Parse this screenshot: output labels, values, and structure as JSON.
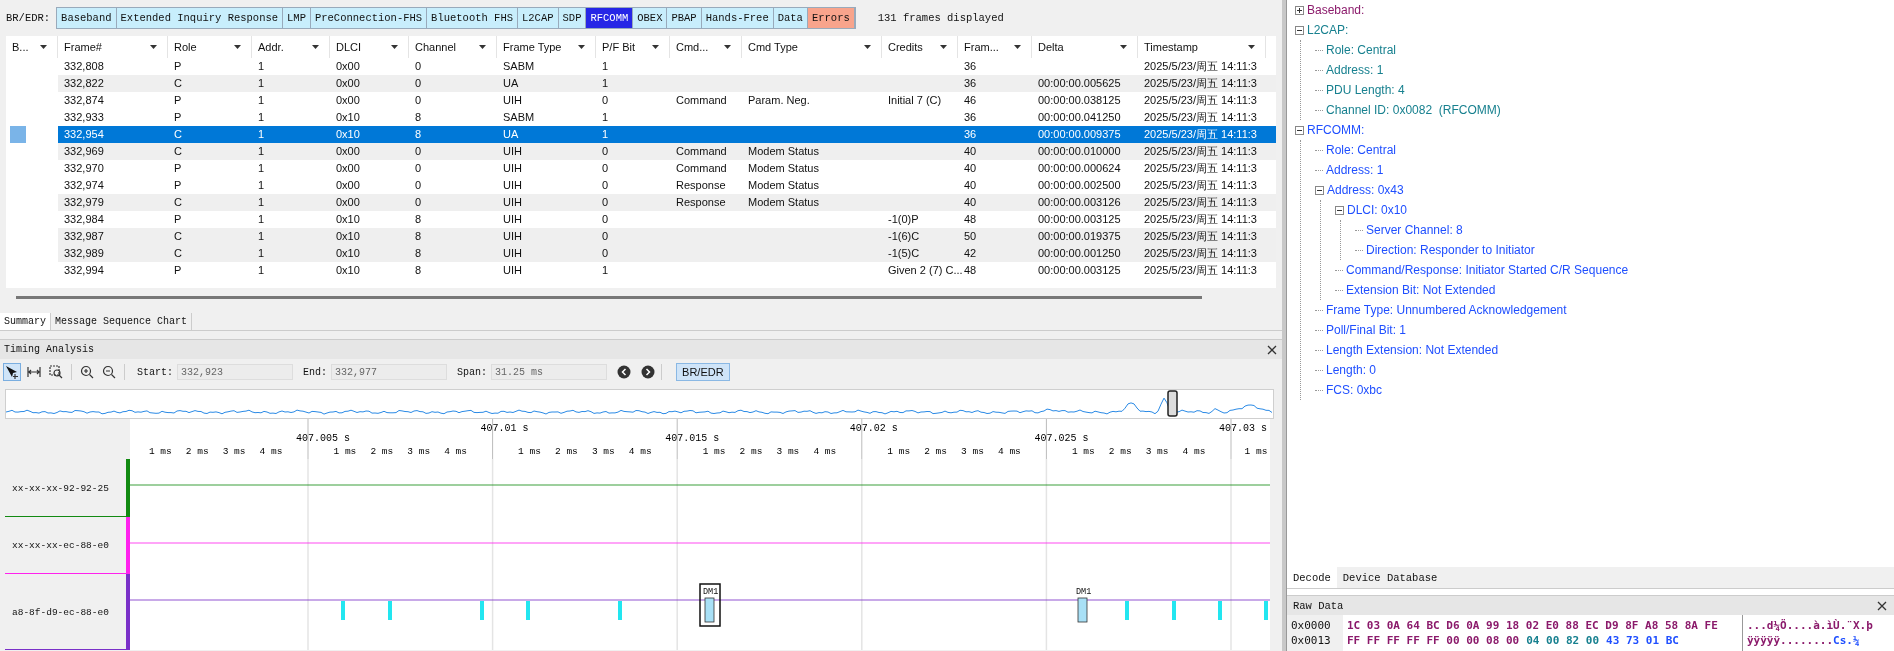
{
  "filter_bar": {
    "label": "BR/EDR:",
    "tabs": [
      {
        "label": "Baseband",
        "kind": "protocol",
        "selected": false
      },
      {
        "label": "Extended Inquiry Response",
        "kind": "protocol",
        "selected": false
      },
      {
        "label": "LMP",
        "kind": "protocol",
        "selected": false
      },
      {
        "label": "PreConnection-FHS",
        "kind": "protocol",
        "selected": false
      },
      {
        "label": "Bluetooth FHS",
        "kind": "protocol",
        "selected": false
      },
      {
        "label": "L2CAP",
        "kind": "protocol",
        "selected": false
      },
      {
        "label": "SDP",
        "kind": "protocol",
        "selected": false
      },
      {
        "label": "RFCOMM",
        "kind": "protocol",
        "selected": true
      },
      {
        "label": "OBEX",
        "kind": "protocol",
        "selected": false
      },
      {
        "label": "PBAP",
        "kind": "protocol",
        "selected": false
      },
      {
        "label": "Hands-Free",
        "kind": "protocol",
        "selected": false
      },
      {
        "label": "Data",
        "kind": "protocol",
        "selected": false
      },
      {
        "label": "Errors",
        "kind": "errors",
        "selected": false
      }
    ],
    "status": "131 frames displayed"
  },
  "table": {
    "columns": [
      "B...",
      "Frame#",
      "Role",
      "Addr.",
      "DLCI",
      "Channel",
      "Frame Type",
      "P/F Bit",
      "Cmd...",
      "Cmd Type",
      "Credits",
      "Fram...",
      "Delta",
      "Timestamp"
    ],
    "rows": [
      {
        "frame": "332,808",
        "role": "P",
        "address": "1",
        "dlci": "0x00",
        "channel": "0",
        "frame_type": "SABM",
        "pf_bit": "1",
        "frame_length": "36",
        "timestamp": "2025/5/23/周五 14:11:3",
        "selected": false,
        "shaded": false
      },
      {
        "frame": "332,822",
        "role": "C",
        "address": "1",
        "dlci": "0x00",
        "channel": "0",
        "frame_type": "UA",
        "pf_bit": "1",
        "frame_length": "36",
        "delta": "00:00:00.005625",
        "timestamp": "2025/5/23/周五 14:11:3",
        "selected": false,
        "shaded": true
      },
      {
        "frame": "332,874",
        "role": "P",
        "address": "1",
        "dlci": "0x00",
        "channel": "0",
        "frame_type": "UIH",
        "pf_bit": "0",
        "cmd": "Command",
        "cmd_type": "Param. Neg.",
        "credits": "Initial 7 (C)",
        "frame_length": "46",
        "delta": "00:00:00.038125",
        "timestamp": "2025/5/23/周五 14:11:3",
        "selected": false,
        "shaded": false
      },
      {
        "frame": "332,933",
        "role": "P",
        "address": "1",
        "dlci": "0x10",
        "channel": "8",
        "frame_type": "SABM",
        "pf_bit": "1",
        "frame_length": "36",
        "delta": "00:00:00.041250",
        "timestamp": "2025/5/23/周五 14:11:3",
        "selected": false,
        "shaded": false
      },
      {
        "frame": "332,954",
        "role": "C",
        "address": "1",
        "dlci": "0x10",
        "channel": "8",
        "frame_type": "UA",
        "pf_bit": "1",
        "frame_length": "36",
        "delta": "00:00:00.009375",
        "timestamp": "2025/5/23/周五 14:11:3",
        "selected": true,
        "shaded": false
      },
      {
        "frame": "332,969",
        "role": "C",
        "address": "1",
        "dlci": "0x00",
        "channel": "0",
        "frame_type": "UIH",
        "pf_bit": "0",
        "cmd": "Command",
        "cmd_type": "Modem Status",
        "frame_length": "40",
        "delta": "00:00:00.010000",
        "timestamp": "2025/5/23/周五 14:11:3",
        "selected": false,
        "shaded": true
      },
      {
        "frame": "332,970",
        "role": "P",
        "address": "1",
        "dlci": "0x00",
        "channel": "0",
        "frame_type": "UIH",
        "pf_bit": "0",
        "cmd": "Command",
        "cmd_type": "Modem Status",
        "frame_length": "40",
        "delta": "00:00:00.000624",
        "timestamp": "2025/5/23/周五 14:11:3",
        "selected": false,
        "shaded": false
      },
      {
        "frame": "332,974",
        "role": "P",
        "address": "1",
        "dlci": "0x00",
        "channel": "0",
        "frame_type": "UIH",
        "pf_bit": "0",
        "cmd": "Response",
        "cmd_type": "Modem Status",
        "frame_length": "40",
        "delta": "00:00:00.002500",
        "timestamp": "2025/5/23/周五 14:11:3",
        "selected": false,
        "shaded": false
      },
      {
        "frame": "332,979",
        "role": "C",
        "address": "1",
        "dlci": "0x00",
        "channel": "0",
        "frame_type": "UIH",
        "pf_bit": "0",
        "cmd": "Response",
        "cmd_type": "Modem Status",
        "frame_length": "40",
        "delta": "00:00:00.003126",
        "timestamp": "2025/5/23/周五 14:11:3",
        "selected": false,
        "shaded": true
      },
      {
        "frame": "332,984",
        "role": "P",
        "address": "1",
        "dlci": "0x10",
        "channel": "8",
        "frame_type": "UIH",
        "pf_bit": "0",
        "credits": "-1(0)P",
        "frame_length": "48",
        "delta": "00:00:00.003125",
        "timestamp": "2025/5/23/周五 14:11:3",
        "selected": false,
        "shaded": false
      },
      {
        "frame": "332,987",
        "role": "C",
        "address": "1",
        "dlci": "0x10",
        "channel": "8",
        "frame_type": "UIH",
        "pf_bit": "0",
        "credits": "-1(6)C",
        "frame_length": "50",
        "delta": "00:00:00.019375",
        "timestamp": "2025/5/23/周五 14:11:3",
        "selected": false,
        "shaded": true
      },
      {
        "frame": "332,989",
        "role": "C",
        "address": "1",
        "dlci": "0x10",
        "channel": "8",
        "frame_type": "UIH",
        "pf_bit": "0",
        "credits": "-1(5)C",
        "frame_length": "42",
        "delta": "00:00:00.001250",
        "timestamp": "2025/5/23/周五 14:11:3",
        "selected": false,
        "shaded": true
      },
      {
        "frame": "332,994",
        "role": "P",
        "address": "1",
        "dlci": "0x10",
        "channel": "8",
        "frame_type": "UIH",
        "pf_bit": "1",
        "credits": "Given 2 (7) C...",
        "frame_length": "48",
        "delta": "00:00:00.003125",
        "timestamp": "2025/5/23/周五 14:11:3",
        "selected": false,
        "shaded": false
      }
    ]
  },
  "view_tabs": [
    {
      "label": "Summary",
      "selected": true
    },
    {
      "label": "Message Sequence Chart",
      "selected": false
    }
  ],
  "timing": {
    "title": "Timing Analysis",
    "tools": [
      {
        "kind": "pointer",
        "selected": true
      },
      {
        "kind": "measure",
        "selected": false
      },
      {
        "kind": "zoom-region",
        "selected": false
      },
      {
        "kind": "zoom-in",
        "selected": false
      },
      {
        "kind": "zoom-out",
        "selected": false
      }
    ],
    "fields": [
      {
        "label": "Start:",
        "value": "332,923"
      },
      {
        "label": "End:",
        "value": "332,977"
      },
      {
        "label": "Span:",
        "value": "31.25 ms"
      }
    ],
    "transport_button": {
      "label": "BR/EDR",
      "selected": true
    },
    "ruler": {
      "major": [
        "407.005 s",
        "407.01 s",
        "407.015 s",
        "407.02 s",
        "407.025 s",
        "407.03 s"
      ],
      "minor": [
        [
          "1 ms",
          "2 ms",
          "3 ms",
          "4 ms"
        ],
        [
          "1 ms",
          "2 ms",
          "3 ms",
          "4 ms"
        ],
        [
          "1 ms",
          "2 ms",
          "3 ms",
          "4 ms"
        ],
        [
          "1 ms",
          "2 ms",
          "3 ms",
          "4 ms"
        ],
        [
          "1 ms",
          "2 ms",
          "3 ms",
          "4 ms"
        ],
        [
          "1 ms",
          "2 ms",
          "3 ms",
          "4 ms"
        ],
        [
          "1 ms"
        ]
      ]
    },
    "lanes": [
      {
        "name": "xx-xx-xx-92-92-25",
        "color": "#128a12"
      },
      {
        "name": "xx-xx-xx-ec-88-e0",
        "color": "#ff22ee"
      },
      {
        "name": "a8-8f-d9-ec-88-e0",
        "color": "#7a30c8",
        "packets": [
          {
            "label": "DM1",
            "selected": true
          },
          {
            "label": "DM1",
            "selected": false
          }
        ]
      }
    ]
  },
  "decode": {
    "tree": [
      {
        "text": "Baseband:",
        "color": "#8b1a6b",
        "expanded": false
      },
      {
        "text": "L2CAP:",
        "color": "#17808f",
        "expanded": true,
        "children": [
          {
            "text": "Role: Central"
          },
          {
            "text": "Address: 1"
          },
          {
            "text": "PDU Length: 4"
          },
          {
            "text": "Channel ID: 0x0082  (RFCOMM)"
          }
        ]
      },
      {
        "text": "RFCOMM:",
        "color": "#1f4fff",
        "expanded": true,
        "children": [
          {
            "text": "Role: Central"
          },
          {
            "text": "Address: 1"
          },
          {
            "text": "Address: 0x43",
            "expanded": true,
            "children": [
              {
                "text": "DLCI: 0x10",
                "expanded": true,
                "children": [
                  {
                    "text": "Server Channel: 8"
                  },
                  {
                    "text": "Direction: Responder to Initiator"
                  }
                ]
              },
              {
                "text": "Command/Response: Initiator Started C/R Sequence"
              },
              {
                "text": "Extension Bit: Not Extended"
              }
            ]
          },
          {
            "text": "Frame Type: Unnumbered Acknowledgement"
          },
          {
            "text": "Poll/Final Bit: 1"
          },
          {
            "text": "Length Extension: Not Extended"
          },
          {
            "text": "Length: 0"
          },
          {
            "text": "FCS: 0xbc"
          }
        ]
      }
    ]
  },
  "side_tabs": [
    {
      "label": "Decode",
      "selected": true
    },
    {
      "label": "Device Database",
      "selected": false
    }
  ],
  "raw_data": {
    "title": "Raw Data",
    "rows": [
      {
        "offset": "0x0000",
        "bytes": [
          {
            "text": "1C 03 0A 64 BC D6 0A 99 18 02 E0 88 EC D9 8F A8 58 8A FE",
            "color": "#8b1a6b"
          }
        ],
        "ascii": [
          {
            "text": "...d¼Ö....à.ìÙ.¨X.þ",
            "color": "#8b1a6b"
          }
        ]
      },
      {
        "offset": "0x0013",
        "bytes": [
          {
            "text": "FF FF FF FF FF 00 00 08 00",
            "color": "#8b1a6b"
          },
          {
            "text": "04 00 82 00",
            "color": "#17808f"
          },
          {
            "text": "43 73 01 BC",
            "color": "#1f4fff"
          }
        ],
        "ascii": [
          {
            "text": "ÿÿÿÿÿ........",
            "color": "#8b1a6b"
          },
          {
            "text": "Cs.¼",
            "color": "#1f4fff"
          }
        ]
      }
    ]
  }
}
